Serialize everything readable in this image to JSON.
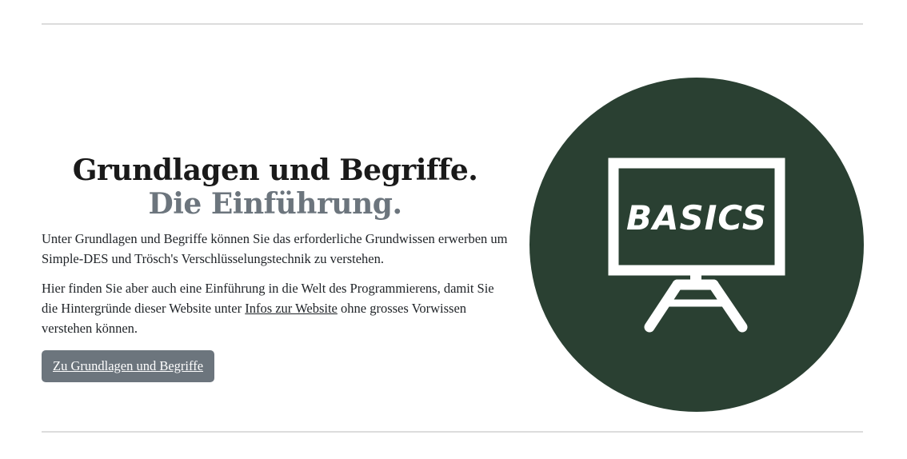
{
  "section": {
    "heading_main": "Grundlagen und Begriffe.",
    "heading_muted": "Die Einführung.",
    "paragraph1": "Unter Grundlagen und Begriffe können Sie das erforderliche Grundwissen erwerben um Simple-DES und Trösch's Verschlüsselungstechnik zu verstehen.",
    "paragraph2_before": "Hier finden Sie aber auch eine Einführung in die Welt des Programmierens, damit Sie die Hintergründe dieser Website unter ",
    "paragraph2_link": "Infos zur Website",
    "paragraph2_after": " ohne grosses Vorwissen verstehen können.",
    "button_label": "Zu Grundlagen und Begriffe"
  },
  "illustration": {
    "icon": "blackboard-easel-icon",
    "board_text": "BASICS",
    "circle_color": "#2a4032",
    "line_color": "#ffffff"
  },
  "colors": {
    "muted": "#6c757d",
    "text": "#212529",
    "rule": "#dcdcdc"
  }
}
